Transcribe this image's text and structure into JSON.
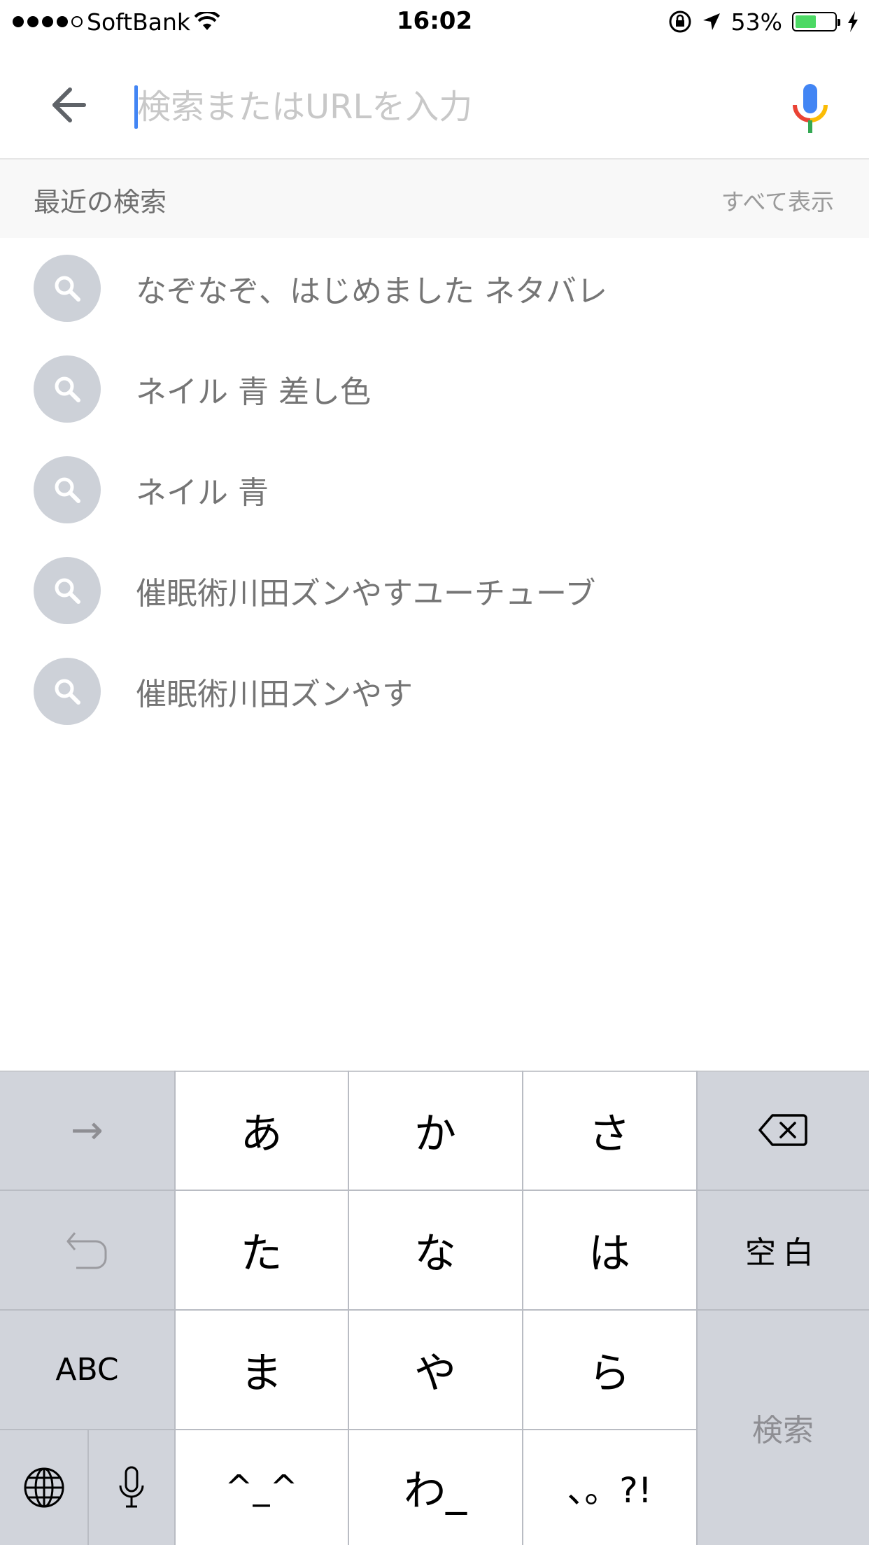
{
  "status_bar": {
    "carrier": "SoftBank",
    "time": "16:02",
    "battery": "53%",
    "battery_level": 0.53
  },
  "search": {
    "placeholder": "検索またはURLを入力",
    "value": ""
  },
  "recent": {
    "title": "最近の検索",
    "show_all": "すべて表示",
    "items": [
      {
        "label": "なぞなぞ、はじめました ネタバレ"
      },
      {
        "label": "ネイル 青 差し色"
      },
      {
        "label": "ネイル 青"
      },
      {
        "label": "催眠術川田ズンやすユーチューブ"
      },
      {
        "label": "催眠術川田ズンやす"
      }
    ]
  },
  "keyboard": {
    "arrow": "→",
    "keys_row1": [
      "あ",
      "か",
      "さ"
    ],
    "keys_row2": [
      "た",
      "な",
      "は"
    ],
    "keys_row3": [
      "ま",
      "や",
      "ら"
    ],
    "keys_row4": [
      "^_^",
      "わ_",
      "、。?!"
    ],
    "space": "空白",
    "abc": "ABC",
    "search": "検索"
  },
  "colors": {
    "accent": "#4285f4",
    "key_gray": "#d1d4db",
    "result_icon_bg": "#cdd1d8",
    "battery_fill": "#4cd964"
  }
}
